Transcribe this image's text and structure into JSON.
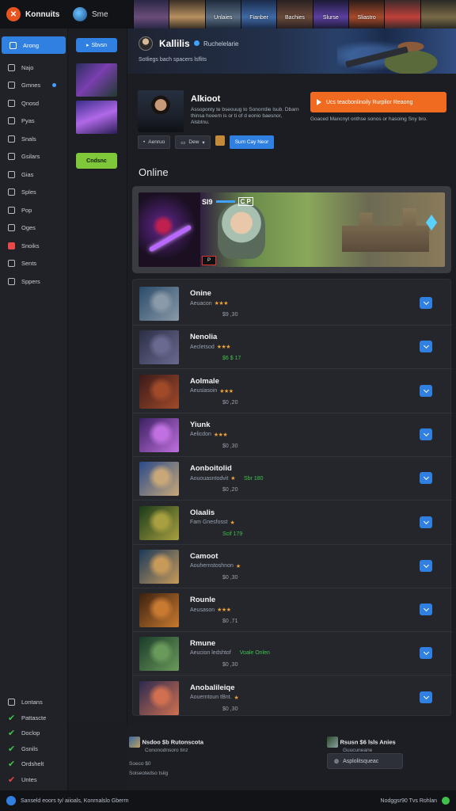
{
  "topbar": {
    "brand": "Konnuits",
    "store": "Sme",
    "tiles": [
      {
        "label": "",
        "color_a": "#2b2745",
        "color_b": "#6a4d7a"
      },
      {
        "label": "",
        "color_a": "#3a2f25",
        "color_b": "#b89060"
      },
      {
        "label": "Unlaies",
        "color_a": "#1d2a3a",
        "color_b": "#5c6f86"
      },
      {
        "label": "Fianber",
        "color_a": "#1a2b4a",
        "color_b": "#3e6aa6"
      },
      {
        "label": "Bachies",
        "color_a": "#2a2020",
        "color_b": "#6a4a3a"
      },
      {
        "label": "Slurse",
        "color_a": "#1c1a35",
        "color_b": "#5b3fa0"
      },
      {
        "label": "Sliastro",
        "color_a": "#2a1c18",
        "color_b": "#a84a2a"
      },
      {
        "label": "",
        "color_a": "#3a2a2a",
        "color_b": "#c0403a"
      },
      {
        "label": "",
        "color_a": "#2a2a24",
        "color_b": "#7a6a48"
      }
    ]
  },
  "sidebar": {
    "items": [
      {
        "label": "Arong",
        "icon": "store-icon"
      },
      {
        "label": "Najo",
        "icon": "home-icon"
      },
      {
        "label": "Gmnes",
        "icon": "games-icon"
      },
      {
        "label": "Qnosd",
        "icon": "edit-icon"
      },
      {
        "label": "Pyas",
        "icon": "bookmark-icon"
      },
      {
        "label": "Snals",
        "icon": "clock-icon"
      },
      {
        "label": "Gsilars",
        "icon": "gallery-icon"
      },
      {
        "label": "Gias",
        "icon": "circle-icon"
      },
      {
        "label": "Sples",
        "icon": "refresh-icon"
      },
      {
        "label": "Pop",
        "icon": "folder-icon"
      },
      {
        "label": "Oges",
        "icon": "grid-icon"
      },
      {
        "label": "Snoiks",
        "icon": "alert-icon"
      },
      {
        "label": "Sents",
        "icon": "gift-icon"
      },
      {
        "label": "Sppers",
        "icon": "settings-icon"
      }
    ],
    "bottom": [
      {
        "label": "Lontans",
        "mark": "square"
      },
      {
        "label": "Pattascte",
        "mark": "check"
      },
      {
        "label": "Doclop",
        "mark": "check"
      },
      {
        "label": "Gsnils",
        "mark": "check"
      },
      {
        "label": "Ordshelt",
        "mark": "check"
      },
      {
        "label": "Untes",
        "mark": "red"
      }
    ]
  },
  "subcol": {
    "top_button": "Sbvsn",
    "green_button": "Cndsnc"
  },
  "hero": {
    "title": "Kallilis",
    "subtitle": "Ruchelelarie",
    "tag": "Sotliegs bach spacers lsflits"
  },
  "profile": {
    "name": "Alkioot",
    "description": "Assoponty te bseouug to Sonorrdie lsub. Dbarn thinsa hoeem is or ti of d eonio baesnor, Alsbtnu.",
    "cta": "Ucs teacbonlinoily Rurplior Reaong",
    "cta_note": "Goaced Mancnyt onthse sonos or hasoing Sny bro.",
    "buttons": [
      "Aenruo",
      "Dew",
      "Sum Cay Neor"
    ]
  },
  "section_title": "Online",
  "banner": {
    "hud_left": "Sl9",
    "hud_right": "C P",
    "hud_small": "P"
  },
  "games": [
    {
      "title": "Onine",
      "meta": "Aeuacon",
      "stars": "★★★",
      "extra": "",
      "price": "$9 ,30",
      "price_green": false,
      "c1": "#2a4a6a",
      "c2": "#8a9aa8"
    },
    {
      "title": "Nenolia",
      "meta": "Aecletsod",
      "stars": "★★★",
      "extra": "",
      "price": "$6 $ 17",
      "price_green": true,
      "c1": "#2a2f45",
      "c2": "#6a6a90"
    },
    {
      "title": "Aolmale",
      "meta": "Aeusiasoin",
      "stars": "★★★",
      "extra": "",
      "price": "$0 ,20",
      "price_green": false,
      "c1": "#3a1a1a",
      "c2": "#a04a2a"
    },
    {
      "title": "Yiunk",
      "meta": "Aelicdon",
      "stars": "★★★",
      "extra": "",
      "price": "$0 ,30",
      "price_green": false,
      "c1": "#3a2060",
      "c2": "#c070e0"
    },
    {
      "title": "Aonboitolid",
      "meta": "Aououasntodvit",
      "stars": "★",
      "extra": "Sbr 180",
      "price": "$0 ,20",
      "price_green": false,
      "c1": "#2a4a8a",
      "c2": "#c8a878"
    },
    {
      "title": "Olaalis",
      "meta": "Fam  Gnesfosst",
      "stars": "★",
      "extra": "",
      "price": "Scif 179",
      "price_green": true,
      "c1": "#1a3a1a",
      "c2": "#a8a040"
    },
    {
      "title": "Camoot",
      "meta": "Aouhernstoshnon",
      "stars": "★",
      "extra": "",
      "price": "$0 ,30",
      "price_green": false,
      "c1": "#1a3a5a",
      "c2": "#c89a5a"
    },
    {
      "title": "Rounle",
      "meta": "Aeusason",
      "stars": "★★★",
      "extra": "",
      "price": "$0 ,71",
      "price_green": false,
      "c1": "#3a2010",
      "c2": "#c87a30"
    },
    {
      "title": "Rmune",
      "meta": "Aeucion ledshtof",
      "stars": "",
      "extra": "Voale Onlen",
      "price": "$0 ,30",
      "price_green": false,
      "c1": "#1a3a2a",
      "c2": "#6a9a5a"
    },
    {
      "title": "Anobalileiqe",
      "meta": "Aouerntoun tBnt.",
      "stars": "★",
      "extra": "",
      "price": "$0 ,30",
      "price_green": false,
      "c1": "#2a2a50",
      "c2": "#d07050"
    }
  ],
  "bottom": {
    "left_title": "Nsdoo $b Rutonscota",
    "left_sub": "Cononodnsoro tinz",
    "left_line1": "Soeco $0",
    "left_line2": "Soiseotedso tsiig",
    "right_title": "Rsusn $6 lsls Anies",
    "right_sub": "Guucuneane",
    "right_button": "Asplolitsqueac"
  },
  "footer": {
    "left": "Sanseld eoors ty/ aiioals, Konrnalslo Gberrn",
    "right": "Nodggsr90 Tvs  Rohlan"
  },
  "colors": {
    "accent": "#2f80e0",
    "cta": "#f06a1f",
    "green": "#3fc24b",
    "bg": "#1b1d22"
  }
}
